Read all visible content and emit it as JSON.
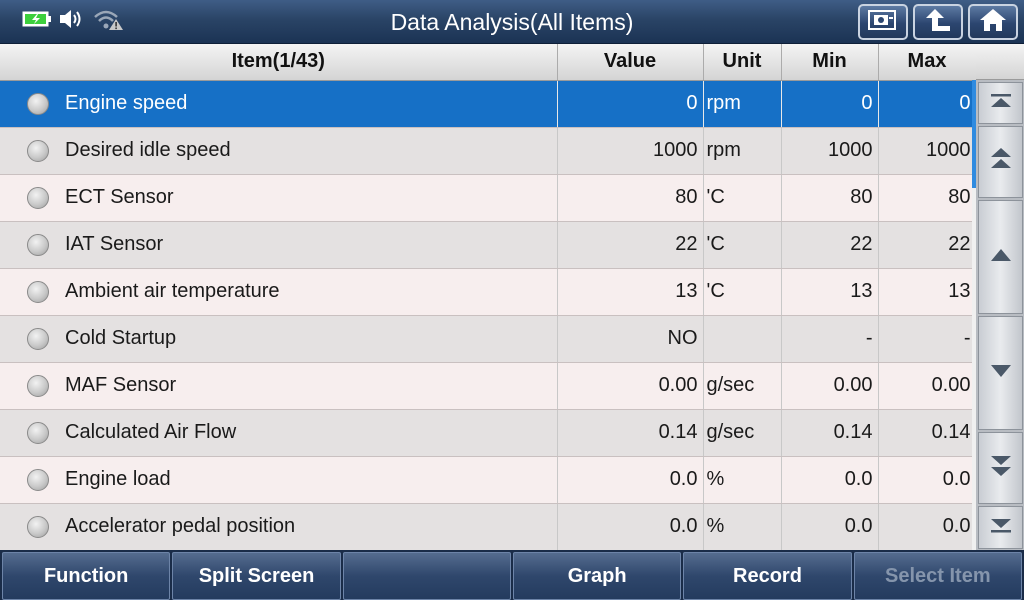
{
  "header": {
    "title": "Data Analysis(All Items)",
    "status_icons": [
      "battery-charging-icon",
      "speaker-icon",
      "wifi-warning-icon"
    ],
    "buttons": [
      "screenshot-icon",
      "back-up-arrow-icon",
      "home-icon"
    ]
  },
  "table": {
    "columns": {
      "item": "Item(1/43)",
      "value": "Value",
      "unit": "Unit",
      "min": "Min",
      "max": "Max"
    },
    "rows": [
      {
        "item": "Engine speed",
        "value": "0",
        "unit": "rpm",
        "min": "0",
        "max": "0",
        "selected": true
      },
      {
        "item": "Desired idle speed",
        "value": "1000",
        "unit": "rpm",
        "min": "1000",
        "max": "1000"
      },
      {
        "item": "ECT Sensor",
        "value": "80",
        "unit": "'C",
        "min": "80",
        "max": "80"
      },
      {
        "item": "IAT Sensor",
        "value": "22",
        "unit": "'C",
        "min": "22",
        "max": "22"
      },
      {
        "item": "Ambient air temperature",
        "value": "13",
        "unit": "'C",
        "min": "13",
        "max": "13"
      },
      {
        "item": "Cold Startup",
        "value": "NO",
        "unit": "",
        "min": "-",
        "max": "-"
      },
      {
        "item": "MAF Sensor",
        "value": "0.00",
        "unit": "g/sec",
        "min": "0.00",
        "max": "0.00"
      },
      {
        "item": "Calculated Air Flow",
        "value": "0.14",
        "unit": "g/sec",
        "min": "0.14",
        "max": "0.14"
      },
      {
        "item": "Engine load",
        "value": "0.0",
        "unit": "%",
        "min": "0.0",
        "max": "0.0"
      },
      {
        "item": "Accelerator pedal position",
        "value": "0.0",
        "unit": "%",
        "min": "0.0",
        "max": "0.0"
      }
    ]
  },
  "scroll_buttons": [
    "scroll-top-icon",
    "page-up-icon",
    "line-up-icon",
    "line-down-icon",
    "page-down-icon",
    "scroll-bottom-icon"
  ],
  "toolbar": {
    "function_label": "Function",
    "split_screen_label": "Split Screen",
    "empty_label": "",
    "graph_label": "Graph",
    "record_label": "Record",
    "select_item_label": "Select Item"
  },
  "colors": {
    "selection": "#1670c6",
    "header_bar": "#2a4466",
    "battery": "#3ccf3c",
    "scrollbar_thumb": "#2f8be0"
  }
}
